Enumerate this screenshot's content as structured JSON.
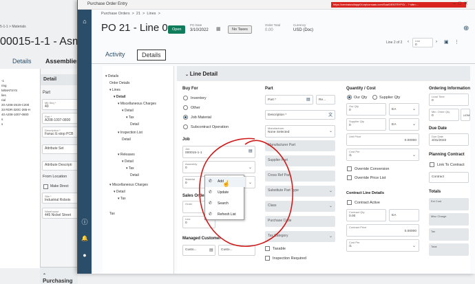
{
  "bg": {
    "crumb": "5-1-1  >  Materials",
    "title": "00015-1-1 - Asm: 0",
    "tabs": [
      "Details",
      "Assemblies"
    ],
    "left_items": [
      "-1",
      "ring",
      "M/MATSYS",
      "lies",
      "rial",
      "20 A208-2519-C200",
      "33 RDR-320C-265-H",
      "40 A208-1007-0800",
      "s",
      "s"
    ],
    "detail_title": "Detail",
    "part_head": "Part",
    "mtl_seq_label": "Mtl Seq *",
    "mtl_seq_value": "40",
    "part_label": "Part *",
    "part_value": "A208-1007-0800",
    "desc_label": "Description *",
    "desc_value": "Fanuc E-stop PCB",
    "attr_set": "Attribute Set",
    "attr_desc": "Attribute Descripti",
    "from_location": "From Location",
    "make_direct": "Make Direct",
    "site_label": "Site *",
    "site_value": "Industrial Robotx",
    "wh_label": "Warehouse",
    "wh_value": "445 Nickel Street",
    "purchasing": "Purchasing"
  },
  "win": {
    "title": "Purchase Order Entry",
    "url": "https://centralusdtapp04.epicorsaas.com/SaaS/ENTRYPO/... ?  site=..."
  },
  "crumb": [
    "Purchase Orders",
    ">",
    "21",
    ">",
    "Lines",
    ">"
  ],
  "po": {
    "title": "PO 21 - Line 0",
    "status": "Open",
    "po_date_label": "PO Date",
    "po_date": "3/10/2022",
    "taxes": "No Taxes",
    "order_total_label": "Order Total",
    "order_total": "0.00",
    "currency_label": "Currency",
    "currency": "USD (Doc)",
    "line_nav": "Line 2 of 2",
    "line_label": "Line",
    "line_value": "0"
  },
  "tabs": [
    "Activity",
    "Details"
  ],
  "tree": [
    "Details",
    "Order Details",
    "Lines",
    "Detail",
    "Miscellaneous Charges",
    "Detail",
    "Tax",
    "Detail",
    "Inspection List",
    "Detail",
    "Releases",
    "Detail",
    "Tax",
    "Detail",
    "Miscellaneous Charges",
    "Detail",
    "Tax",
    "Tax"
  ],
  "panel": {
    "title": "Line Detail",
    "buy_for": "Buy For",
    "buy_opts": [
      "Inventory",
      "Other",
      "Job Material",
      "Subcontract Operation"
    ],
    "job_head": "Job",
    "job_label": "Job",
    "job_value": "000015-1-1",
    "asm_label": "Assembly",
    "asm_value": "0",
    "mtl_label": "Material",
    "mtl_value": "0",
    "sales_order": "Sales Order",
    "order_label": "Order",
    "line_label": "Line",
    "line_value": "0",
    "managed_customer": "Managed Customer",
    "custo": "Custo...",
    "custo2": "Custo...",
    "part_head": "Part",
    "part_field": "Part *",
    "rev": "Re...",
    "desc": "Description *",
    "mfr_label": "Manufacturer",
    "mfr_value": "None Selected",
    "mfr_part": "Manufacturer Part",
    "supplier_part": "Supplier Part",
    "cross_ref": "Cross Ref Part",
    "subst": "Substitute Part Type",
    "class": "Class",
    "purchase_code": "Purchase Code",
    "tax_category": "Tax Category",
    "taxable": "Taxable",
    "insp": "Inspection Required",
    "qty_head": "Quantity / Cost",
    "our_qty": "Our Qty",
    "supplier_qty": "Supplier Qty",
    "our_qty_label": "Our Qty",
    "our_qty_value": "0",
    "uom1": "EA",
    "sup_qty_label": "Supplier Qty",
    "sup_qty_value": "0",
    "uom2": "EA",
    "unit_price": "Unit Price",
    "unit_price_value": "0.00000",
    "cost_per_label": "Cost Per",
    "cost_per_value": "/1",
    "override_conv": "Override Conversion",
    "override_price": "Override Price List",
    "contract_head": "Contract Line Details",
    "contract_active": "Contract Active",
    "contract_qty_label": "Contract Qty",
    "contract_qty_value": "0.00",
    "uom3": "EA",
    "contract_price_label": "Contract Price",
    "contract_price_value": "0.00000",
    "cost_per2_label": "Cost Per",
    "cost_per2_value": "/1",
    "ord_info": "Ordering Information",
    "lead_time_label": "Lead Time",
    "lead_time_value": "0",
    "min_order_label": "Min. Order Qty",
    "min_order_value": "0",
    "uom_label": "UOM",
    "due_date_head": "Due Date",
    "due_date_label": "Due Date",
    "due_date_value": "3/31/2022",
    "planning": "Planning Contract",
    "link_contract": "Link To Contract",
    "contract": "Contract",
    "totals": "Totals",
    "ext_cost": "Ext Cost",
    "misc_charge": "Misc Charge",
    "tax": "Tax",
    "total": "Total"
  },
  "menu": [
    "Add",
    "Update",
    "Search",
    "Refresh List"
  ],
  "colors": {
    "accent": "#2a4d69",
    "open_badge": "#0f7d5c",
    "annotation": "#d01818",
    "red_bar": "#d9231f"
  }
}
